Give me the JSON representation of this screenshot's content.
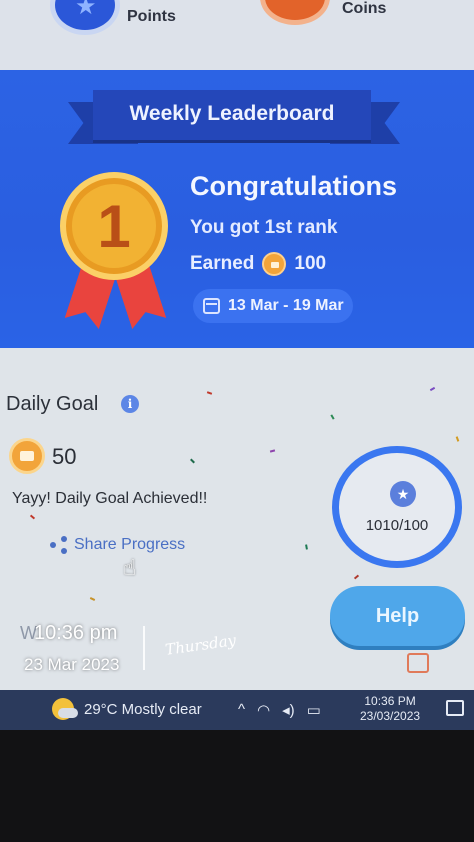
{
  "topbar": {
    "points_label": "Points",
    "coins_label": "Coins",
    "icons": [
      "star-icon",
      "coin-box-icon"
    ]
  },
  "banner": {
    "ribbon_title": "Weekly Leaderboard",
    "medal_number": "1",
    "headline": "Congratulations",
    "rank_text": "You got 1st rank",
    "earned_label": "Earned",
    "earned_value": "100",
    "date_range": "13 Mar - 19 Mar"
  },
  "daily_goal": {
    "title": "Daily Goal",
    "info": "i",
    "points": "50",
    "status": "Yayy! Daily Goal Achieved!!",
    "share_label": "Share Progress",
    "progress_text": "1010/100",
    "progress_fraction": 1.0,
    "behind_text": "W"
  },
  "help": {
    "label": "Help"
  },
  "taskbar": {
    "weather": "29°C  Mostly clear",
    "tray_icons": [
      "^",
      "wifi-icon",
      "speaker-icon",
      "battery-icon"
    ],
    "time": "10:36 PM",
    "date": "23/03/2023"
  },
  "overlay": {
    "time": "10:36 pm",
    "date": "23 Mar 2023",
    "day": "Thursday"
  },
  "colors": {
    "banner_blue": "#2c63e4",
    "ring_blue": "#3a77f0",
    "help_blue": "#4fa7ea",
    "medal_gold": "#f2b233",
    "strap_red": "#e9443e"
  }
}
